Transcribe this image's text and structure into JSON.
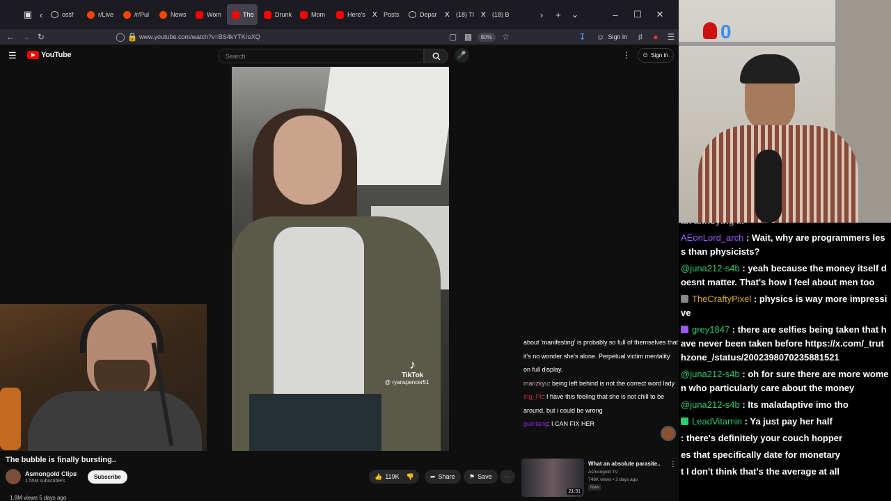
{
  "browser": {
    "tabs": [
      {
        "label": "ossf",
        "icon": "circle-icon",
        "active": false
      },
      {
        "label": "r/Live",
        "icon": "reddit-icon",
        "active": false
      },
      {
        "label": "/r/Pul",
        "icon": "reddit-icon",
        "active": false
      },
      {
        "label": "News",
        "icon": "reddit-icon",
        "active": false
      },
      {
        "label": "Wom",
        "icon": "youtube-icon",
        "active": false
      },
      {
        "label": "The",
        "icon": "youtube-icon",
        "active": true
      },
      {
        "label": "Drunk",
        "icon": "youtube-icon",
        "active": false
      },
      {
        "label": "Mom",
        "icon": "youtube-icon",
        "active": false
      },
      {
        "label": "Here's",
        "icon": "youtube-icon",
        "active": false
      },
      {
        "label": "Posts",
        "icon": "x-icon",
        "active": false
      },
      {
        "label": "Depar",
        "icon": "circle-icon",
        "active": false
      },
      {
        "label": "(18) Tl",
        "icon": "x-icon",
        "active": false
      },
      {
        "label": "(18) B",
        "icon": "x-icon",
        "active": false
      }
    ],
    "url": "www.youtube.com/watch?v=BS4kYTKroXQ",
    "zoom": "80%",
    "signin_label": "Sign in"
  },
  "youtube": {
    "logo_text": "YouTube",
    "search_placeholder": "Search",
    "signin_label": "Sign in",
    "video_title": "The bubble is finally bursting..",
    "channel": "Asmongold Clips",
    "subscribers": "1.55M subscribers",
    "subscribe_label": "Subscribe",
    "likes": "119K",
    "share_label": "Share",
    "save_label": "Save",
    "views_line": "1.8M views  5 days ago",
    "tiktok_label": "TikTok",
    "tiktok_user": "@ ryanspencer51",
    "recommended": {
      "title": "What an absolute parasite..",
      "channel": "Asmongold TV",
      "meta": "748K views • 2 days ago",
      "badge": "New",
      "duration": "21:31"
    }
  },
  "overlay_chat": [
    {
      "user": "",
      "text": "about 'manifesting' is probably so full of themselves that it's no wonder she's alone. Perpetual victim mentality on full display.",
      "color": "#ffffff"
    },
    {
      "user": "marizkyu",
      "text": "being left behind is not the correct word lady",
      "color": "#c8a0a0"
    },
    {
      "user": "Ing_Pit",
      "text": "I have this feeling that she is not chill to be around, but i could be wrong",
      "color": "#c22b2b"
    },
    {
      "user": "gumtang",
      "text": "I CAN FIX HER",
      "color": "#8a2be2"
    }
  ],
  "stream": {
    "counter": "0"
  },
  "chat": [
    {
      "user": "",
      "text": "an annoying ...",
      "color": "#ffffff",
      "badge": ""
    },
    {
      "user": "AEonLord_arch",
      "text": "Wait, why are programmers less than physicists?",
      "color": "#9b59ff",
      "badge": ""
    },
    {
      "user": "@juna212-s4b",
      "text": "yeah because the money itself doesnt matter. That's how I feel about men too",
      "color": "#2ecc71",
      "badge": ""
    },
    {
      "user": "TheCraftyPixel",
      "text": "physics is way more impressive",
      "color": "#daa520",
      "badge": "pixel"
    },
    {
      "user": "grey1847",
      "text": "there are selfies being taken that have never been taken before https://x.com/_truthzone_/status/2002398070235881521",
      "color": "#2ecc71",
      "badge": "purple"
    },
    {
      "user": "@juna212-s4b",
      "text": "oh for sure there are more women who particularly care about the money",
      "color": "#2ecc71",
      "badge": ""
    },
    {
      "user": "@juna212-s4b",
      "text": "Its maladaptive imo tho",
      "color": "#2ecc71",
      "badge": ""
    },
    {
      "user": "LeadVitamin",
      "text": "Ya just pay her half",
      "color": "#2ecc71",
      "badge": "green"
    },
    {
      "user": "",
      "text": ": there's definitely your couch hopper",
      "color": "#ffffff",
      "badge": ""
    },
    {
      "user": "",
      "text": "es that specifically date for monetary",
      "color": "#ffffff",
      "badge": ""
    },
    {
      "user": "",
      "text": "t I don't think that's the average at all",
      "color": "#ffffff",
      "badge": ""
    }
  ],
  "colors": {
    "accent": "#ff0000",
    "chat_green": "#2ecc71",
    "chat_purple": "#9b59ff"
  }
}
